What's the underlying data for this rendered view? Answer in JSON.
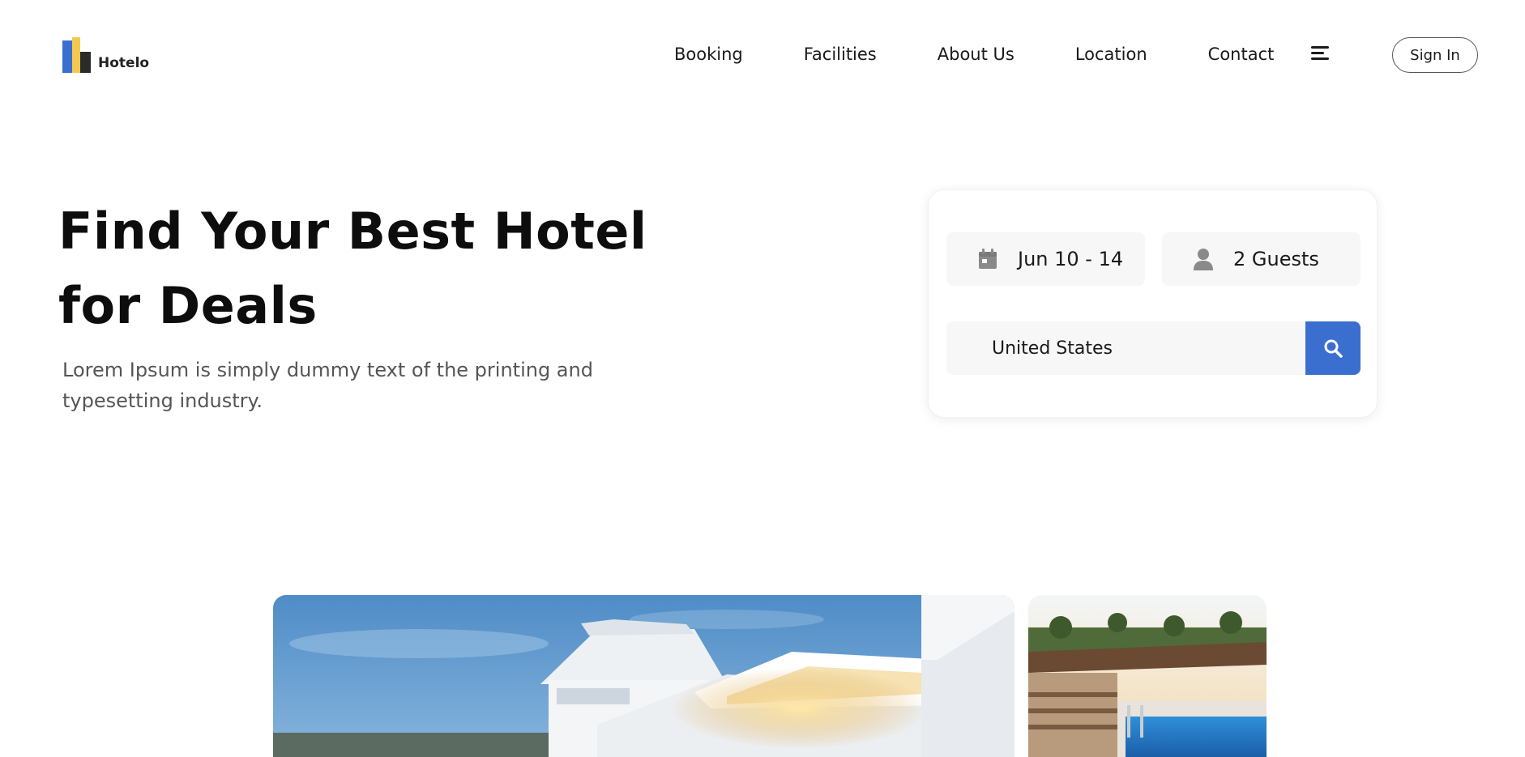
{
  "brand": {
    "name": "Hotelo",
    "colors": {
      "blue": "#3b6fcf",
      "yellow": "#f3c94f",
      "dark": "#2b2b2b"
    }
  },
  "nav": {
    "links": [
      {
        "label": "Booking"
      },
      {
        "label": "Facilities"
      },
      {
        "label": "About Us"
      },
      {
        "label": "Location"
      },
      {
        "label": "Contact"
      }
    ],
    "menu_icon": "hamburger-menu-icon",
    "signin_label": "Sign In"
  },
  "hero": {
    "title": "Find Your Best Hotel for Deals",
    "subtitle": "Lorem Ipsum is simply dummy text of the printing and typesetting industry."
  },
  "booking": {
    "dates": {
      "icon": "calendar-icon",
      "value": "Jun 10 - 14"
    },
    "guests": {
      "icon": "user-icon",
      "value": "2 Guests"
    },
    "location": {
      "value": "United States"
    },
    "search_icon": "search-icon",
    "accent": "#3b6fcf"
  },
  "gallery": {
    "images": [
      {
        "name": "hotel-exterior-photo"
      },
      {
        "name": "pool-photo"
      }
    ]
  }
}
